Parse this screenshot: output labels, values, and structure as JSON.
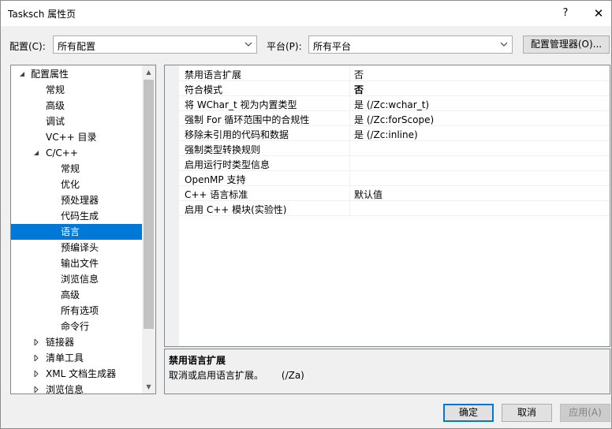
{
  "window": {
    "title": "Tasksch 属性页",
    "help_label": "?",
    "close_label": "✕"
  },
  "toolbar": {
    "config_label": "配置(C):",
    "config_value": "所有配置",
    "platform_label": "平台(P):",
    "platform_value": "所有平台",
    "config_manager_label": "配置管理器(O)..."
  },
  "tree": {
    "items": [
      {
        "label": "配置属性",
        "level": 0,
        "expander": "expanded"
      },
      {
        "label": "常规",
        "level": 1,
        "expander": "none"
      },
      {
        "label": "高级",
        "level": 1,
        "expander": "none"
      },
      {
        "label": "调试",
        "level": 1,
        "expander": "none"
      },
      {
        "label": "VC++ 目录",
        "level": 1,
        "expander": "none"
      },
      {
        "label": "C/C++",
        "level": 1,
        "expander": "expanded"
      },
      {
        "label": "常规",
        "level": 2,
        "expander": "none"
      },
      {
        "label": "优化",
        "level": 2,
        "expander": "none"
      },
      {
        "label": "预处理器",
        "level": 2,
        "expander": "none"
      },
      {
        "label": "代码生成",
        "level": 2,
        "expander": "none"
      },
      {
        "label": "语言",
        "level": 2,
        "expander": "none",
        "selected": true
      },
      {
        "label": "预编译头",
        "level": 2,
        "expander": "none"
      },
      {
        "label": "输出文件",
        "level": 2,
        "expander": "none"
      },
      {
        "label": "浏览信息",
        "level": 2,
        "expander": "none"
      },
      {
        "label": "高级",
        "level": 2,
        "expander": "none"
      },
      {
        "label": "所有选项",
        "level": 2,
        "expander": "none"
      },
      {
        "label": "命令行",
        "level": 2,
        "expander": "none"
      },
      {
        "label": "链接器",
        "level": 1,
        "expander": "collapsed"
      },
      {
        "label": "清单工具",
        "level": 1,
        "expander": "collapsed"
      },
      {
        "label": "XML 文档生成器",
        "level": 1,
        "expander": "collapsed"
      },
      {
        "label": "浏览信息",
        "level": 1,
        "expander": "collapsed"
      }
    ]
  },
  "properties": {
    "rows": [
      {
        "name": "禁用语言扩展",
        "value": "否",
        "bold": false,
        "selected": true
      },
      {
        "name": "符合模式",
        "value": "否",
        "bold": true
      },
      {
        "name": "将 WChar_t 视为内置类型",
        "value": "是 (/Zc:wchar_t)",
        "bold": false
      },
      {
        "name": "强制 For 循环范围中的合规性",
        "value": "是 (/Zc:forScope)",
        "bold": false
      },
      {
        "name": "移除未引用的代码和数据",
        "value": "是 (/Zc:inline)",
        "bold": false
      },
      {
        "name": "强制类型转换规则",
        "value": "",
        "bold": false
      },
      {
        "name": "启用运行时类型信息",
        "value": "",
        "bold": false
      },
      {
        "name": "OpenMP 支持",
        "value": "",
        "bold": false
      },
      {
        "name": "C++ 语言标准",
        "value": "默认值",
        "bold": false
      },
      {
        "name": "启用 C++ 模块(实验性)",
        "value": "",
        "bold": false
      }
    ]
  },
  "description": {
    "title": "禁用语言扩展",
    "text": "取消或启用语言扩展。      (/Za)"
  },
  "buttons": {
    "ok": "确定",
    "cancel": "取消",
    "apply": "应用(A)"
  }
}
